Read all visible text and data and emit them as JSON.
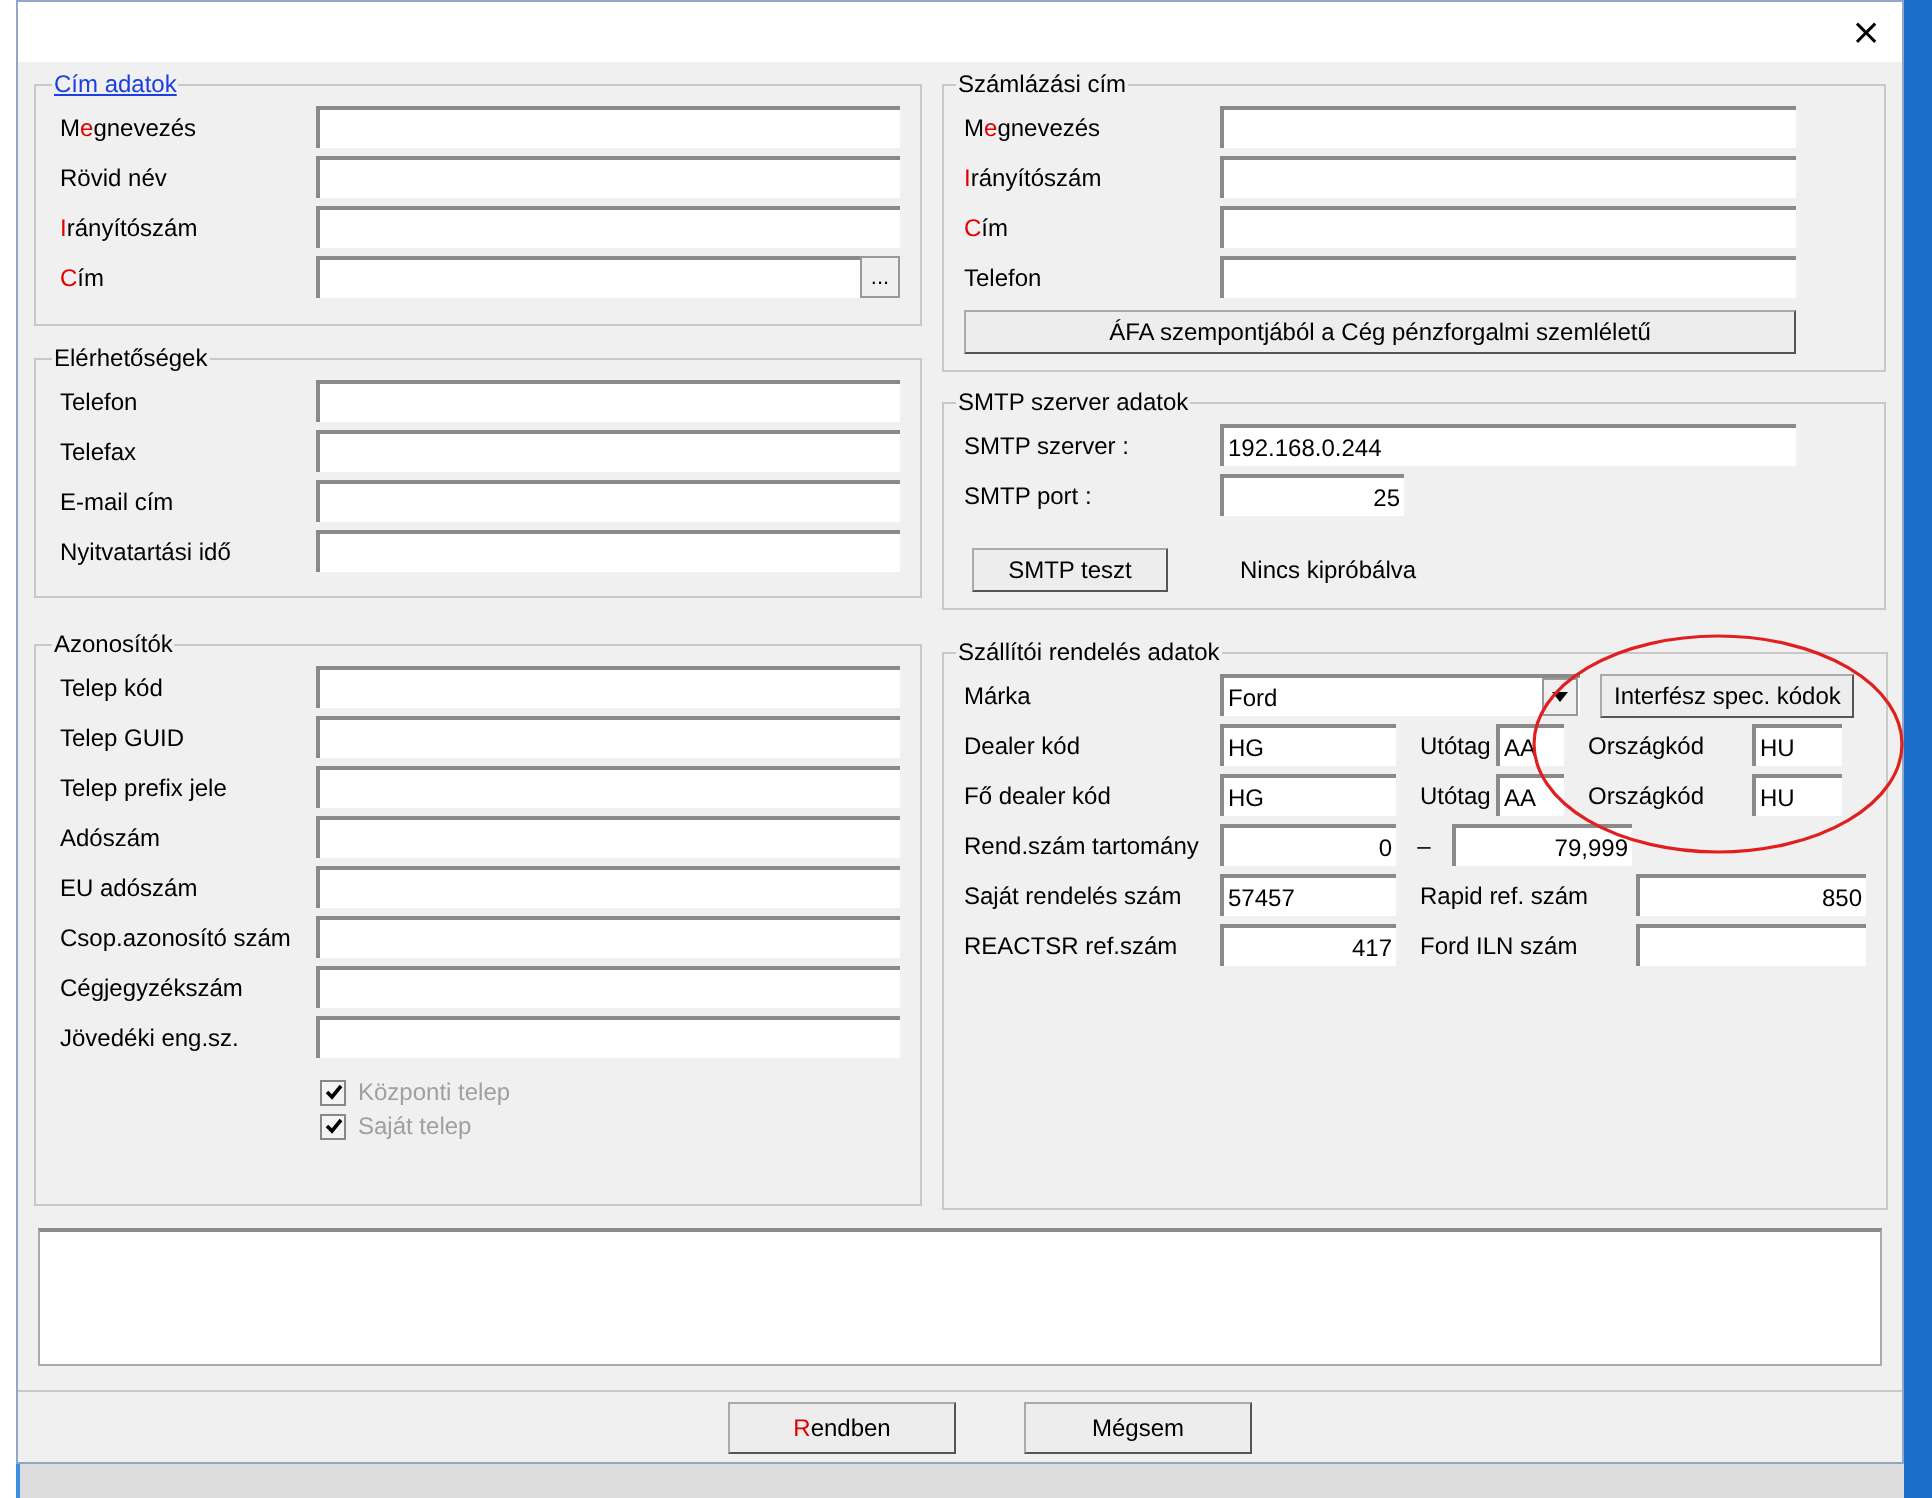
{
  "window": {
    "close": "×"
  },
  "left_groups": [
    {
      "title": "Cím adatok",
      "link": true,
      "fields": [
        {
          "label": [
            {
              "text": "M",
              "highlight": false
            },
            {
              "text": "e",
              "highlight": true
            },
            {
              "text": "gnevezés",
              "highlight": false
            }
          ]
        },
        {
          "label": [
            {
              "text": "Rövid név",
              "highlight": false
            }
          ]
        },
        {
          "label": [
            {
              "text": "I",
              "highlight": true
            },
            {
              "text": "rányítószám",
              "highlight": false
            }
          ]
        },
        {
          "label": [
            {
              "text": "C",
              "highlight": true
            },
            {
              "text": "ím",
              "highlight": false
            }
          ],
          "browse": "..."
        }
      ]
    },
    {
      "title": "Elérhetőségek",
      "link": false,
      "fields": [
        {
          "label": [
            {
              "text": "Telefon",
              "highlight": false
            }
          ]
        },
        {
          "label": [
            {
              "text": "Telefax",
              "highlight": false
            }
          ]
        },
        {
          "label": [
            {
              "text": "E-mail cím",
              "highlight": false
            }
          ]
        },
        {
          "label": [
            {
              "text": "Nyitvatartási idő",
              "highlight": false
            }
          ]
        }
      ]
    },
    {
      "title": "Azonosítók",
      "link": false,
      "fields": [
        {
          "label": [
            {
              "text": "Telep kód",
              "highlight": false
            }
          ]
        },
        {
          "label": [
            {
              "text": "Telep GUID",
              "highlight": false
            }
          ]
        },
        {
          "label": [
            {
              "text": "Telep prefix jele",
              "highlight": false
            }
          ]
        },
        {
          "label": [
            {
              "text": "Adószám",
              "highlight": false
            }
          ]
        },
        {
          "label": [
            {
              "text": "EU adószám",
              "highlight": false
            }
          ]
        },
        {
          "label": [
            {
              "text": "Csop.azonosító szám",
              "highlight": false
            }
          ]
        },
        {
          "label": [
            {
              "text": "Cégjegyzékszám",
              "highlight": false
            }
          ]
        },
        {
          "label": [
            {
              "text": "Jövedéki eng.sz.",
              "highlight": false
            }
          ]
        }
      ],
      "checkboxes": [
        {
          "label": "Központi telep",
          "checked": true,
          "disabled": true
        },
        {
          "label": "Saját telep",
          "checked": true,
          "disabled": true
        }
      ]
    }
  ],
  "billing": {
    "title": "Számlázási cím",
    "fields": [
      {
        "label": [
          {
            "text": "M",
            "highlight": false
          },
          {
            "text": "e",
            "highlight": true
          },
          {
            "text": "gnevezés",
            "highlight": false
          }
        ]
      },
      {
        "label": [
          {
            "text": "I",
            "highlight": true
          },
          {
            "text": "rányítószám",
            "highlight": false
          }
        ]
      },
      {
        "label": [
          {
            "text": "C",
            "highlight": true
          },
          {
            "text": "ím",
            "highlight": false
          }
        ]
      },
      {
        "label": [
          {
            "text": "Telefon",
            "highlight": false
          }
        ]
      }
    ],
    "button": "ÁFA szempontjából a Cég pénzforgalmi szemléletű"
  },
  "smtp": {
    "title": "SMTP szerver adatok",
    "server_label": "SMTP szerver :",
    "server": "192.168.0.244",
    "port_label": "SMTP port :",
    "port": "25",
    "test_button": "SMTP teszt",
    "test_status": "Nincs kipróbálva"
  },
  "order": {
    "title": "Szállítói rendelés adatok",
    "highlight_ellipse": true,
    "rows": [
      {
        "kind": "combo",
        "label": "Márka",
        "value": "Ford",
        "button": "Interfész spec. kódok"
      },
      {
        "kind": "code",
        "label": "Dealer kód",
        "code": "HG",
        "suffix_label": "Utótag",
        "suffix": "AA",
        "country_label": "Országkód",
        "country": "HU"
      },
      {
        "kind": "code",
        "label": "Fő dealer kód",
        "code": "HG",
        "suffix_label": "Utótag",
        "suffix": "AA",
        "country_label": "Országkód",
        "country": "HU"
      },
      {
        "kind": "range",
        "label": "Rend.szám tartomány",
        "from": "0",
        "dash": "–",
        "to": "79,999"
      },
      {
        "kind": "pair",
        "label": "Saját rendelés szám",
        "value": "57457",
        "right_aligned": false,
        "label2": "Rapid ref. szám",
        "value2": "850"
      },
      {
        "kind": "pair",
        "label": "REACTSR ref.szám",
        "value": "417",
        "right_aligned": true,
        "label2": "Ford ILN szám"
      }
    ]
  },
  "buttons": [
    {
      "label": [
        {
          "text": "R",
          "highlight": true
        },
        {
          "text": "endben",
          "highlight": false
        }
      ]
    },
    {
      "label": [
        {
          "text": "Mégsem",
          "highlight": false
        }
      ]
    }
  ]
}
